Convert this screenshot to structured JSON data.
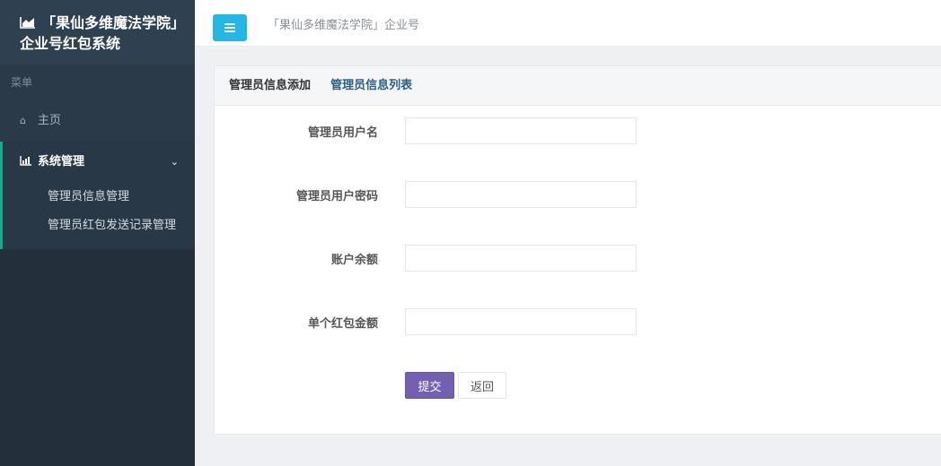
{
  "app": {
    "title": "「果仙多维魔法学院」企业号红包系统"
  },
  "sidebar": {
    "menu_caption": "菜单",
    "home_label": "主页",
    "group_label": "系统管理",
    "sub_items": [
      {
        "label": "管理员信息管理"
      },
      {
        "label": "管理员红包发送记录管理"
      }
    ]
  },
  "topbar": {
    "page_tab": "「果仙多维魔法学院」企业号"
  },
  "panel": {
    "tabs": [
      {
        "label": "管理员信息添加"
      },
      {
        "label": "管理员信息列表"
      }
    ]
  },
  "form": {
    "fields": [
      {
        "label": "管理员用户名",
        "value": ""
      },
      {
        "label": "管理员用户密码",
        "value": ""
      },
      {
        "label": "账户余额",
        "value": ""
      },
      {
        "label": "单个红包金额",
        "value": ""
      }
    ],
    "submit_label": "提交",
    "back_label": "返回"
  },
  "colors": {
    "sidebar_bg": "#2b3a48",
    "accent_blue": "#23b7e5",
    "submit_purple": "#7460b3"
  }
}
